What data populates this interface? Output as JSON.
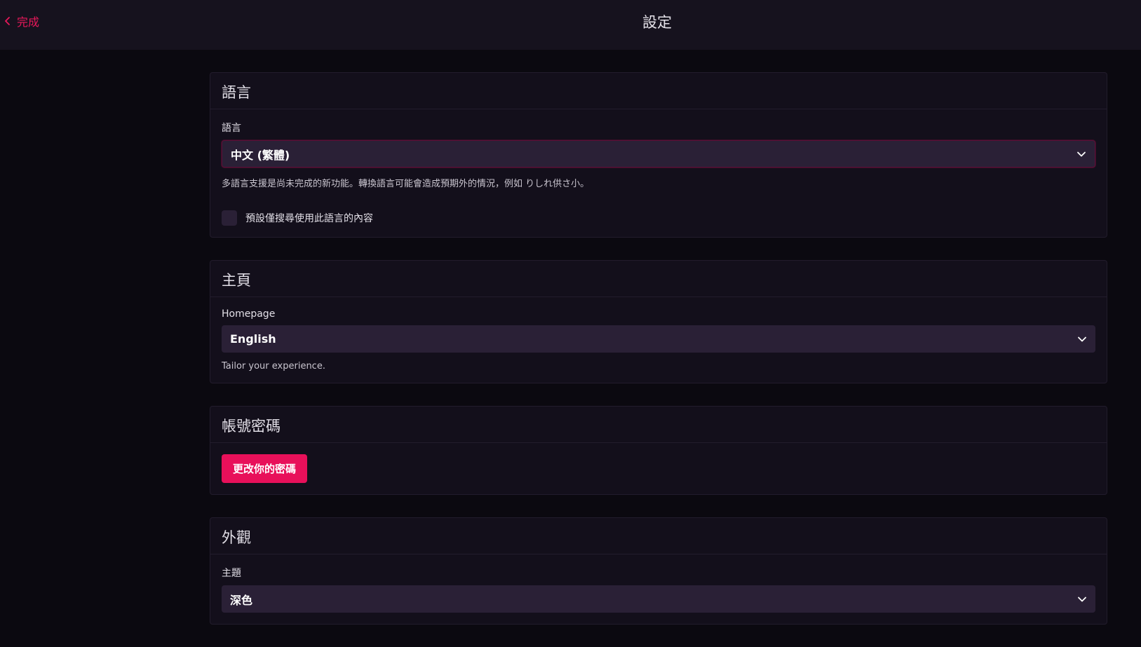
{
  "header": {
    "back_label": "完成",
    "title": "設定"
  },
  "sections": {
    "language": {
      "title": "語言",
      "field_label": "語言",
      "selected": "中文 (繁體)",
      "help": "多語言支援是尚未完成的新功能。轉換語言可能會造成預期外的情況，例如 りしれ供さ小。",
      "checkbox_label": "預設僅搜尋使用此語言的內容",
      "checkbox_checked": false
    },
    "homepage": {
      "title": "主頁",
      "field_label": "Homepage",
      "selected": "English",
      "help": "Tailor your experience."
    },
    "account": {
      "title": "帳號密碼",
      "button_label": "更改你的密碼"
    },
    "appearance": {
      "title": "外觀",
      "field_label": "主題",
      "selected": "深色"
    }
  },
  "colors": {
    "accent": "#e8105a",
    "background": "#0b0910",
    "card": "#130f1b",
    "input": "#2a2036"
  }
}
